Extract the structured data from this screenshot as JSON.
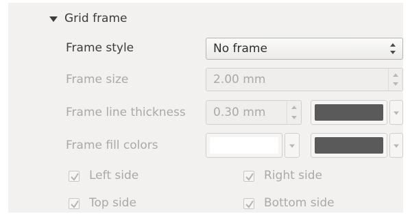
{
  "section": {
    "title": "Grid frame",
    "expanded": true
  },
  "frame_style": {
    "label": "Frame style",
    "value": "No frame"
  },
  "frame_size": {
    "label": "Frame size",
    "value": "2.00 mm"
  },
  "frame_line_thickness": {
    "label": "Frame line thickness",
    "value": "0.30 mm",
    "color": "#5a5a5a"
  },
  "frame_fill_colors": {
    "label": "Frame fill colors",
    "color_1": "#ffffff",
    "color_2": "#5a5a5a"
  },
  "sides": {
    "left": {
      "label": "Left side",
      "checked": true
    },
    "right": {
      "label": "Right side",
      "checked": true
    },
    "top": {
      "label": "Top side",
      "checked": true
    },
    "bottom": {
      "label": "Bottom side",
      "checked": true
    }
  }
}
